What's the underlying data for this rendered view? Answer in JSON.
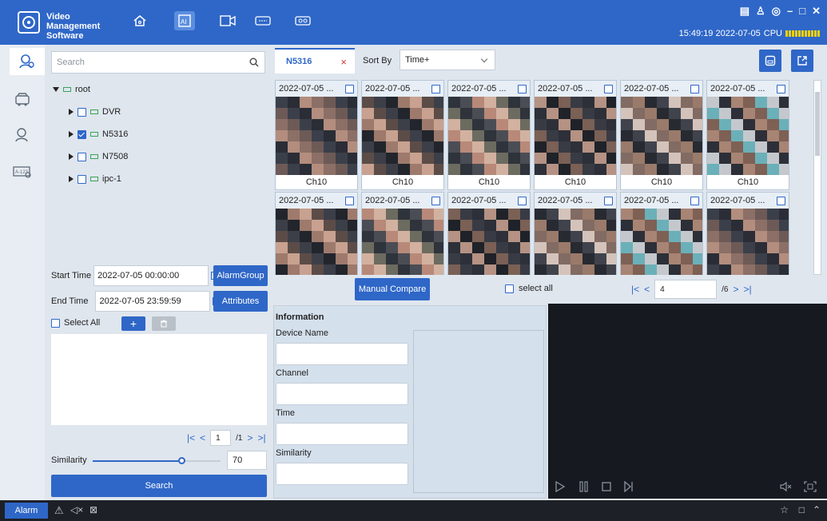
{
  "app": {
    "title": "Video Management Software"
  },
  "header": {
    "time": "15:49:19 2022-07-05",
    "cpu_label": "CPU"
  },
  "search": {
    "placeholder": "Search"
  },
  "tree": {
    "root": "root",
    "items": [
      {
        "label": "DVR",
        "checked": false
      },
      {
        "label": "N5316",
        "checked": true
      },
      {
        "label": "N7508",
        "checked": false
      },
      {
        "label": "ipc-1",
        "checked": false
      }
    ]
  },
  "filters": {
    "start_label": "Start Time",
    "start_value": "2022-07-05 00:00:00",
    "end_label": "End Time",
    "end_value": "2022-07-05 23:59:59",
    "alarm_group": "AlarmGroup",
    "attributes": "Attributes",
    "select_all": "Select All",
    "add": "+"
  },
  "left_pager": {
    "page": "1",
    "total": "/1"
  },
  "similarity": {
    "label": "Similarity",
    "value": "70",
    "level": 0.7
  },
  "search_button": "Search",
  "tab": {
    "label": "N5316",
    "close": "×"
  },
  "sort": {
    "label": "Sort By",
    "value": "Time+"
  },
  "cards_row1": [
    {
      "date": "2022-07-05 ...",
      "channel": "Ch10"
    },
    {
      "date": "2022-07-05 ...",
      "channel": "Ch10"
    },
    {
      "date": "2022-07-05 ...",
      "channel": "Ch10"
    },
    {
      "date": "2022-07-05 ...",
      "channel": "Ch10"
    },
    {
      "date": "2022-07-05 ...",
      "channel": "Ch10"
    },
    {
      "date": "2022-07-05 ...",
      "channel": "Ch10"
    }
  ],
  "cards_row2": [
    {
      "date": "2022-07-05 ..."
    },
    {
      "date": "2022-07-05 ..."
    },
    {
      "date": "2022-07-05 ..."
    },
    {
      "date": "2022-07-05 ..."
    },
    {
      "date": "2022-07-05 ..."
    },
    {
      "date": "2022-07-05 ..."
    }
  ],
  "compare": {
    "manual_compare": "Manual Compare",
    "select_all": "select all",
    "page": "4",
    "total": "/6"
  },
  "info": {
    "title": "Information",
    "device_name": "Device Name",
    "channel": "Channel",
    "time": "Time",
    "similarity": "Similarity"
  },
  "bottom": {
    "alarm": "Alarm"
  },
  "colors": {
    "accent": "#2f67c8",
    "panel": "#dfe6ee",
    "dark": "#1d2027"
  }
}
